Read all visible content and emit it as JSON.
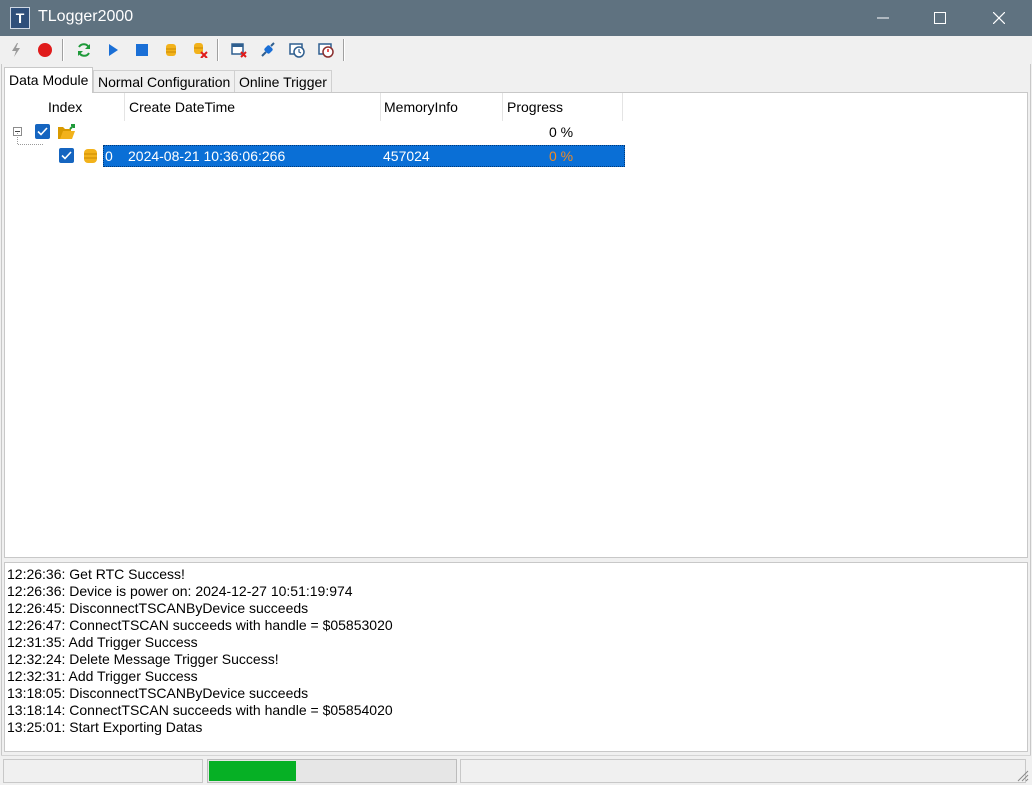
{
  "window": {
    "title": "TLogger2000",
    "app_icon_letter": "T"
  },
  "toolbar": {
    "buttons": [
      {
        "name": "lightning-icon",
        "color": "#9a9a9a"
      },
      {
        "name": "record-icon",
        "color": "#e01b1b"
      },
      {
        "name": "refresh-icon",
        "color": "#1f9a3a"
      },
      {
        "name": "play-icon",
        "color": "#1a6fd6"
      },
      {
        "name": "stop-icon",
        "color": "#1a6fd6"
      },
      {
        "name": "database-icon",
        "color": "#f2b21b"
      },
      {
        "name": "database-delete-icon",
        "color": "#f2b21b"
      },
      {
        "name": "window-delete-icon",
        "color": "#2f5f8f"
      },
      {
        "name": "connect-icon",
        "color": "#1a6fd6"
      },
      {
        "name": "clock-icon",
        "color": "#2f5f8f"
      },
      {
        "name": "clock-delete-icon",
        "color": "#2f5f8f"
      }
    ]
  },
  "tabs": [
    {
      "label": "Data Module",
      "active": true
    },
    {
      "label": "Normal Configuration",
      "active": false
    },
    {
      "label": "Online Trigger",
      "active": false
    }
  ],
  "tree": {
    "columns": [
      "Index",
      "Create DateTime",
      "MemoryInfo",
      "Progress"
    ],
    "root": {
      "progress": "0 %",
      "checked": true,
      "expanded": true
    },
    "rows": [
      {
        "index": "0",
        "create_datetime": "2024-08-21 10:36:06:266",
        "memory_info": "457024",
        "progress": "0 %",
        "checked": true,
        "selected": true
      }
    ]
  },
  "log": {
    "lines": [
      "12:26:36: Get RTC Success!",
      "12:26:36: Device is power on: 2024-12-27 10:51:19:974",
      "12:26:45: DisconnectTSCANByDevice succeeds",
      "12:26:47: ConnectTSCAN succeeds with handle = $05853020",
      "12:31:35: Add Trigger Success",
      "12:32:24: Delete Message Trigger Success!",
      "12:32:31: Add Trigger Success",
      "13:18:05: DisconnectTSCANByDevice succeeds",
      "13:18:14: ConnectTSCAN succeeds with handle = $05854020",
      "13:25:01: Start Exporting Datas"
    ]
  },
  "statusbar": {
    "progress_fraction": 0.35,
    "progress_color": "#06b025"
  },
  "colors": {
    "titlebar": "#5f7280",
    "selection": "#0a6fd6",
    "selected_progress_text": "#f08a24"
  }
}
